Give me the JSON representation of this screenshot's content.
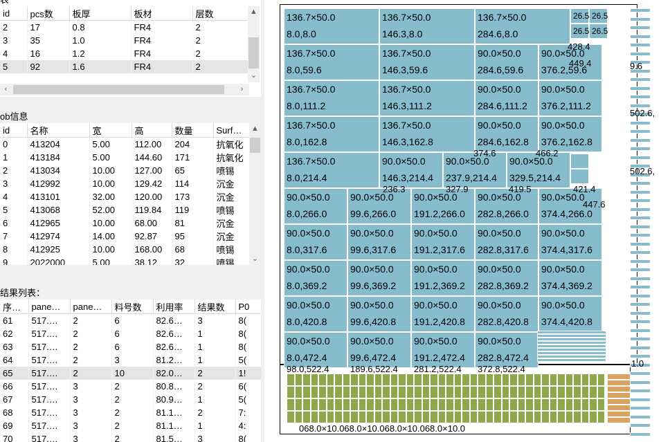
{
  "top_table": {
    "partial_title": "表",
    "columns": [
      "id",
      "pcs数",
      "板厚",
      "板材",
      "层数"
    ],
    "rows": [
      [
        "2",
        "17",
        "0.8",
        "FR4",
        "2"
      ],
      [
        "3",
        "35",
        "1.0",
        "FR4",
        "2"
      ],
      [
        "4",
        "16",
        "1.2",
        "FR4",
        "2"
      ],
      [
        "5",
        "92",
        "1.6",
        "FR4",
        "2"
      ]
    ],
    "selected_row": 3
  },
  "job_table": {
    "label": "ob信息",
    "columns": [
      "id",
      "名称",
      "宽",
      "高",
      "数量",
      "Surf…"
    ],
    "rows": [
      [
        "0",
        "413204",
        "5.00",
        "112.00",
        "204",
        "抗氧化"
      ],
      [
        "1",
        "413184",
        "5.00",
        "144.60",
        "171",
        "抗氧化"
      ],
      [
        "2",
        "413034",
        "10.00",
        "127.00",
        "65",
        "喷锡"
      ],
      [
        "3",
        "412992",
        "10.00",
        "129.42",
        "114",
        "沉金"
      ],
      [
        "4",
        "413101",
        "32.00",
        "120.00",
        "173",
        "沉金"
      ],
      [
        "5",
        "413068",
        "52.00",
        "119.84",
        "119",
        "喷锡"
      ],
      [
        "6",
        "412965",
        "10.00",
        "68.00",
        "81",
        "沉金"
      ],
      [
        "7",
        "412974",
        "14.00",
        "92.87",
        "95",
        "沉金"
      ],
      [
        "8",
        "412925",
        "10.00",
        "168.00",
        "68",
        "喷锡"
      ],
      [
        "9",
        "2022000",
        "5.00",
        "38.12",
        "32",
        "喷锡"
      ]
    ]
  },
  "result_table": {
    "label": "结果列表：",
    "columns": [
      "序…",
      "pane…",
      "pane…",
      "料号数",
      "利用率",
      "结果数",
      "P0"
    ],
    "rows": [
      [
        "61",
        "517.…",
        "2",
        "6",
        "82.6…",
        "3",
        "8("
      ],
      [
        "62",
        "517.…",
        "2",
        "6",
        "82.6…",
        "1",
        "8("
      ],
      [
        "63",
        "517.…",
        "2",
        "6",
        "82.6…",
        "1",
        "8("
      ],
      [
        "64",
        "517.…",
        "2",
        "3",
        "81.2…",
        "1",
        "5("
      ],
      [
        "65",
        "517.…",
        "2",
        "10",
        "82.0…",
        "2",
        "1!"
      ],
      [
        "66",
        "517.…",
        "3",
        "2",
        "80.8…",
        "2",
        "6("
      ],
      [
        "67",
        "517.…",
        "3",
        "2",
        "80.9…",
        "1",
        "5("
      ],
      [
        "68",
        "517.…",
        "3",
        "2",
        "81.1…",
        "2",
        "7:"
      ],
      [
        "69",
        "517.…",
        "3",
        "2",
        "81.1…",
        "1",
        "4:"
      ],
      [
        "70",
        "517.…",
        "3",
        "2",
        "81.5…",
        "3",
        "8("
      ]
    ],
    "selected_row": 4
  },
  "layout": {
    "pieces_row1": [
      {
        "size": "136.7×50.0",
        "pos": "8.0,8.0"
      },
      {
        "size": "136.7×50.0",
        "pos": "146.3,8.0"
      },
      {
        "size": "136.7×50.0",
        "pos": "284.6,8.0"
      }
    ],
    "pieces_rows_136": [
      [
        {
          "size": "136.7×50.0",
          "pos": "8.0,59.6"
        },
        {
          "size": "136.7×50.0",
          "pos": "146.3,59.6"
        }
      ],
      [
        {
          "size": "136.7×50.0",
          "pos": "8.0,111.2"
        },
        {
          "size": "136.7×50.0",
          "pos": "146.3,111.2"
        }
      ],
      [
        {
          "size": "136.7×50.0",
          "pos": "8.0,162.8"
        },
        {
          "size": "136.7×50.0",
          "pos": "146.3,162.8"
        }
      ]
    ],
    "pieces_rows_90_right": [
      [
        {
          "size": "90.0×50.0",
          "pos": "284.6,59.6"
        },
        {
          "size": "90.0×50.0",
          "pos": "376.2,59.6"
        }
      ],
      [
        {
          "size": "90.0×50.0",
          "pos": "284.6,111.2"
        },
        {
          "size": "90.0×50.0",
          "pos": "376.2,111.2"
        }
      ],
      [
        {
          "size": "90.0×50.0",
          "pos": "284.6,162.8"
        },
        {
          "size": "90.0×50.0",
          "pos": "376.2,162.8"
        }
      ]
    ],
    "row_214": [
      {
        "size": "136.7×50.0",
        "pos": "8.0,214.4"
      },
      {
        "size": "90.0×50.0",
        "pos": "146.3,214.4"
      },
      {
        "size": "90.0×50.0",
        "pos": "237.9,214.4"
      },
      {
        "size": "90.0×50.0",
        "pos": "329.5,214.4"
      }
    ],
    "grid_90": [
      [
        {
          "size": "90.0×50.0",
          "pos": "8.0,266.0"
        },
        {
          "size": "90.0×50.0",
          "pos": "99.6,266.0"
        },
        {
          "size": "90.0×50.0",
          "pos": "191.2,266.0"
        },
        {
          "size": "90.0×50.0",
          "pos": "282.8,266.0"
        },
        {
          "size": "90.0×50.0",
          "pos": "374.4,266.0"
        }
      ],
      [
        {
          "size": "90.0×50.0",
          "pos": "8.0,317.6"
        },
        {
          "size": "90.0×50.0",
          "pos": "99.6,317.6"
        },
        {
          "size": "90.0×50.0",
          "pos": "191.2,317.6"
        },
        {
          "size": "90.0×50.0",
          "pos": "282.8,317.6"
        },
        {
          "size": "90.0×50.0",
          "pos": "374.4,317.6"
        }
      ],
      [
        {
          "size": "90.0×50.0",
          "pos": "8.0,369.2"
        },
        {
          "size": "90.0×50.0",
          "pos": "99.6,369.2"
        },
        {
          "size": "90.0×50.0",
          "pos": "191.2,369.2"
        },
        {
          "size": "90.0×50.0",
          "pos": "282.8,369.2"
        },
        {
          "size": "90.0×50.0",
          "pos": "374.4,369.2"
        }
      ],
      [
        {
          "size": "90.0×50.0",
          "pos": "8.0,420.8"
        },
        {
          "size": "90.0×50.0",
          "pos": "99.6,420.8"
        },
        {
          "size": "90.0×50.0",
          "pos": "191.2,420.8"
        },
        {
          "size": "90.0×50.0",
          "pos": "282.8,420.8"
        },
        {
          "size": "90.0×50.0",
          "pos": "374.4,420.8"
        }
      ],
      [
        {
          "size": "90.0×50.0",
          "pos": "8.0,472.4"
        },
        {
          "size": "90.0×50.0",
          "pos": "99.6,472.4"
        },
        {
          "size": "90.0×50.0",
          "pos": "191.2,472.4"
        },
        {
          "size": "90.0×50.0",
          "pos": "282.8,472.4"
        }
      ]
    ],
    "small_26": "26.5",
    "overlap_labels": [
      "236.3",
      "327.9",
      "419.5",
      "374.6",
      "466.2",
      "421.4",
      "447.6",
      "449.4",
      "428.4"
    ],
    "bottom_row_labels": [
      "98.0,522.4",
      "189.6,522.4",
      "281.2,522.4",
      "372.8,522.4"
    ],
    "bottom_strip_text": "068.0×10.068.0×10.068.0×10.068.0×10.0",
    "right_edge_labels": [
      "502.6,",
      "9.6",
      "1.0"
    ],
    "colors": {
      "blue_piece": "#86bccc",
      "green_piece": "#8ea74a",
      "orange_piece": "#d9a35f"
    }
  }
}
